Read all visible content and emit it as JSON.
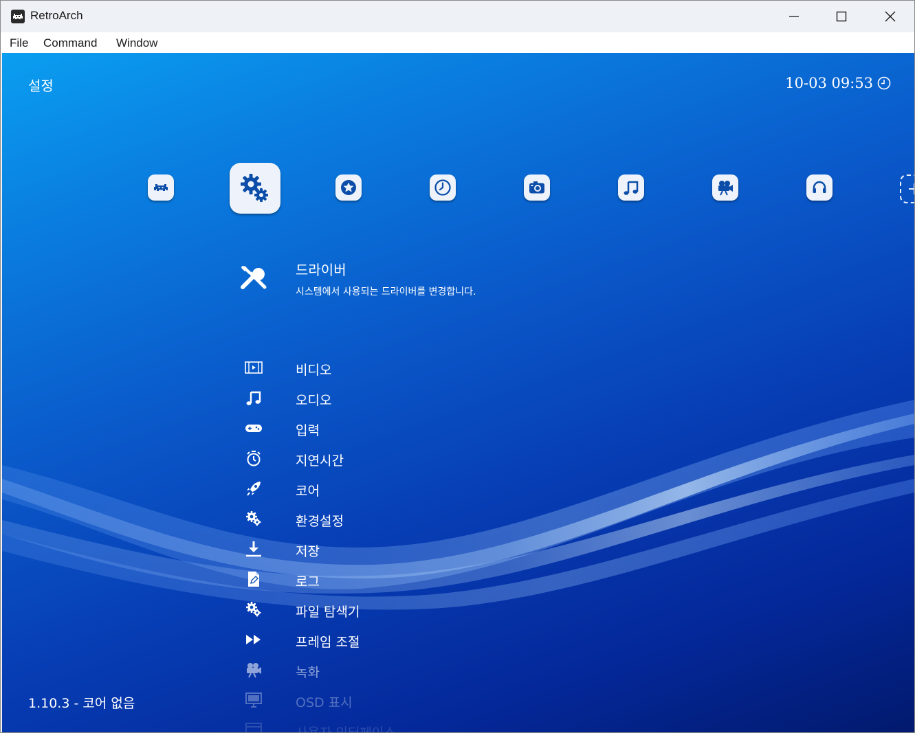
{
  "window": {
    "title": "RetroArch",
    "icon": "retroarch-invader-icon",
    "controls": [
      "minimize-icon",
      "maximize-icon",
      "close-icon"
    ]
  },
  "menubar": {
    "items": [
      "File",
      "Command",
      "Window"
    ]
  },
  "header": {
    "title": "설정",
    "clock": "10-03 09:53",
    "clock_icon": "clock-icon"
  },
  "categories": [
    {
      "icon": "invader-icon",
      "selected": false
    },
    {
      "icon": "settings-gears-icon",
      "selected": true
    },
    {
      "icon": "favorites-star-icon",
      "selected": false
    },
    {
      "icon": "history-clock-icon",
      "selected": false
    },
    {
      "icon": "images-camera-icon",
      "selected": false
    },
    {
      "icon": "music-note-icon",
      "selected": false
    },
    {
      "icon": "video-camera-icon",
      "selected": false
    },
    {
      "icon": "netplay-headset-icon",
      "selected": false
    },
    {
      "icon": "add-icon",
      "selected": false
    }
  ],
  "selected_entry": {
    "label": "드라이버",
    "sublabel": "시스템에서 사용되는 드라이버를 변경합니다.",
    "icon": "tools-icon"
  },
  "list": [
    {
      "label": "비디오",
      "icon": "film-icon",
      "opacity": 1.0
    },
    {
      "label": "오디오",
      "icon": "music-note-icon",
      "opacity": 1.0
    },
    {
      "label": "입력",
      "icon": "gamepad-icon",
      "opacity": 1.0
    },
    {
      "label": "지연시간",
      "icon": "stopwatch-icon",
      "opacity": 1.0
    },
    {
      "label": "코어",
      "icon": "rocket-icon",
      "opacity": 1.0
    },
    {
      "label": "환경설정",
      "icon": "gears-icon",
      "opacity": 1.0
    },
    {
      "label": "저장",
      "icon": "download-icon",
      "opacity": 1.0
    },
    {
      "label": "로그",
      "icon": "document-icon",
      "opacity": 1.0
    },
    {
      "label": "파일 탐색기",
      "icon": "gears-icon",
      "opacity": 1.0
    },
    {
      "label": "프레임 조절",
      "icon": "fast-forward-icon",
      "opacity": 1.0
    },
    {
      "label": "녹화",
      "icon": "video-camera-icon",
      "opacity": 0.55
    },
    {
      "label": "OSD 표시",
      "icon": "monitor-icon",
      "opacity": 0.3
    },
    {
      "label": "사용자 인터페이스",
      "icon": "window-icon",
      "opacity": 0.15
    }
  ],
  "footer": {
    "version": "1.10.3 - 코어 없음"
  },
  "colors": {
    "background_top": "#0a9ef0",
    "background_bottom": "#021a6e",
    "titlebar": "#eef1f6",
    "text": "#ffffff",
    "icon_tile": "#eef3fb",
    "icon_glyph": "#0b4da8"
  }
}
